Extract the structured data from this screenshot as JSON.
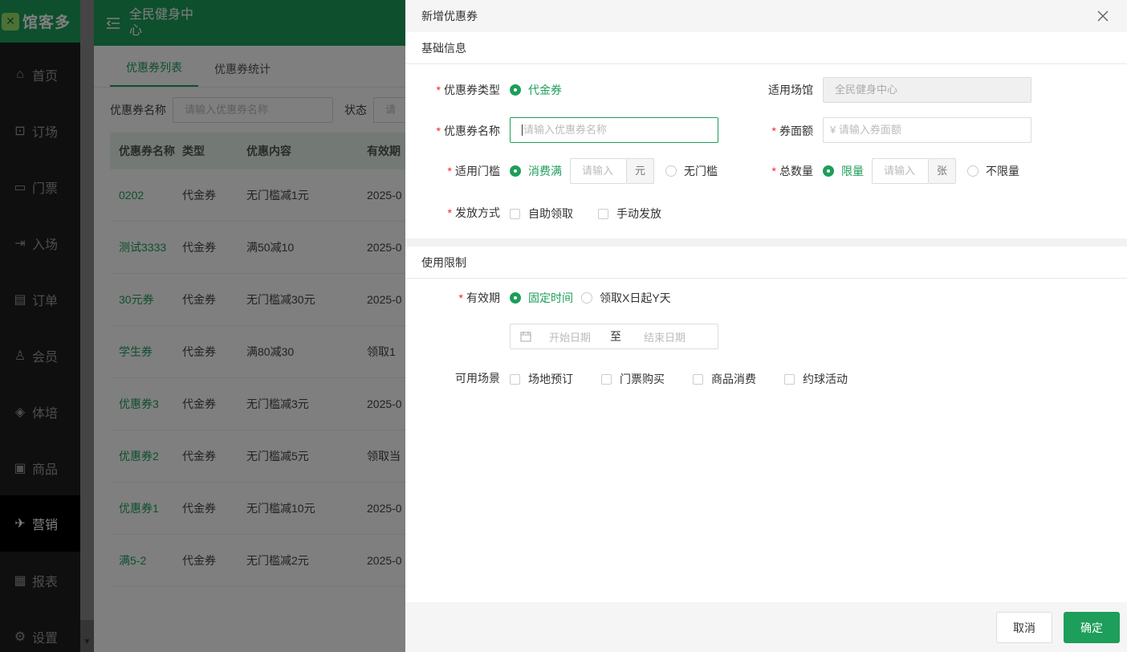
{
  "app": {
    "logo_text": "馆客多",
    "logo_mark": "✕"
  },
  "sidebar": {
    "items": [
      {
        "label": "首页",
        "icon": "home-icon"
      },
      {
        "label": "订场",
        "icon": "booking-icon"
      },
      {
        "label": "门票",
        "icon": "ticket-icon"
      },
      {
        "label": "入场",
        "icon": "entry-icon"
      },
      {
        "label": "订单",
        "icon": "order-icon"
      },
      {
        "label": "会员",
        "icon": "member-icon"
      },
      {
        "label": "体培",
        "icon": "training-icon"
      },
      {
        "label": "商品",
        "icon": "goods-icon"
      },
      {
        "label": "营销",
        "icon": "marketing-icon"
      },
      {
        "label": "报表",
        "icon": "report-icon"
      },
      {
        "label": "设置",
        "icon": "settings-icon"
      }
    ],
    "active": "营销"
  },
  "header": {
    "venue": "全民健身中心"
  },
  "tabs": [
    {
      "label": "优惠券列表"
    },
    {
      "label": "优惠券统计"
    }
  ],
  "filter": {
    "name_label": "优惠券名称",
    "name_placeholder": "请输入优惠券名称",
    "status_label": "状态",
    "status_placeholder": "请"
  },
  "table": {
    "headers": [
      "优惠券名称",
      "类型",
      "优惠内容",
      "有效期"
    ],
    "rows": [
      [
        "0202",
        "代金券",
        "无门槛减1元",
        "2025-0"
      ],
      [
        "测试3333",
        "代金券",
        "满50减10",
        "2025-0"
      ],
      [
        "30元券",
        "代金券",
        "无门槛减30元",
        "2025-0"
      ],
      [
        "学生券",
        "代金券",
        "满80减30",
        "领取1"
      ],
      [
        "优惠券3",
        "代金券",
        "无门槛减3元",
        "2025-0"
      ],
      [
        "优惠券2",
        "代金券",
        "无门槛减5元",
        "领取当"
      ],
      [
        "优惠券1",
        "代金券",
        "无门槛减10元",
        "2025-0"
      ],
      [
        "满5-2",
        "代金券",
        "无门槛减2元",
        "2025-0"
      ]
    ]
  },
  "drawer": {
    "title": "新增优惠券",
    "section_basic": "基础信息",
    "section_limit": "使用限制",
    "coupon_type_label": "优惠券类型",
    "coupon_type_option": "代金券",
    "venue_label": "适用场馆",
    "venue_value": "全民健身中心",
    "name_label": "优惠券名称",
    "name_placeholder": "请输入优惠券名称",
    "face_value_label": "券面额",
    "face_value_placeholder": "¥  请输入券面额",
    "threshold_label": "适用门槛",
    "threshold_option_on": "消费满",
    "threshold_placeholder": "请输入",
    "threshold_unit": "元",
    "threshold_option_off": "无门槛",
    "total_label": "总数量",
    "total_option_on": "限量",
    "total_placeholder": "请输入",
    "total_unit": "张",
    "total_option_off": "不限量",
    "issue_label": "发放方式",
    "issue_self": "自助领取",
    "issue_manual": "手动发放",
    "validity_label": "有效期",
    "validity_fixed": "固定时间",
    "validity_relative": "领取X日起Y天",
    "start_placeholder": "开始日期",
    "range_sep": "至",
    "end_placeholder": "结束日期",
    "scene_label": "可用场景",
    "scenes": [
      "场地预订",
      "门票购买",
      "商品消费",
      "约球活动"
    ],
    "cancel": "取消",
    "confirm": "确定"
  },
  "colors": {
    "brand": "#1d9e5a",
    "required": "#f5222d"
  }
}
